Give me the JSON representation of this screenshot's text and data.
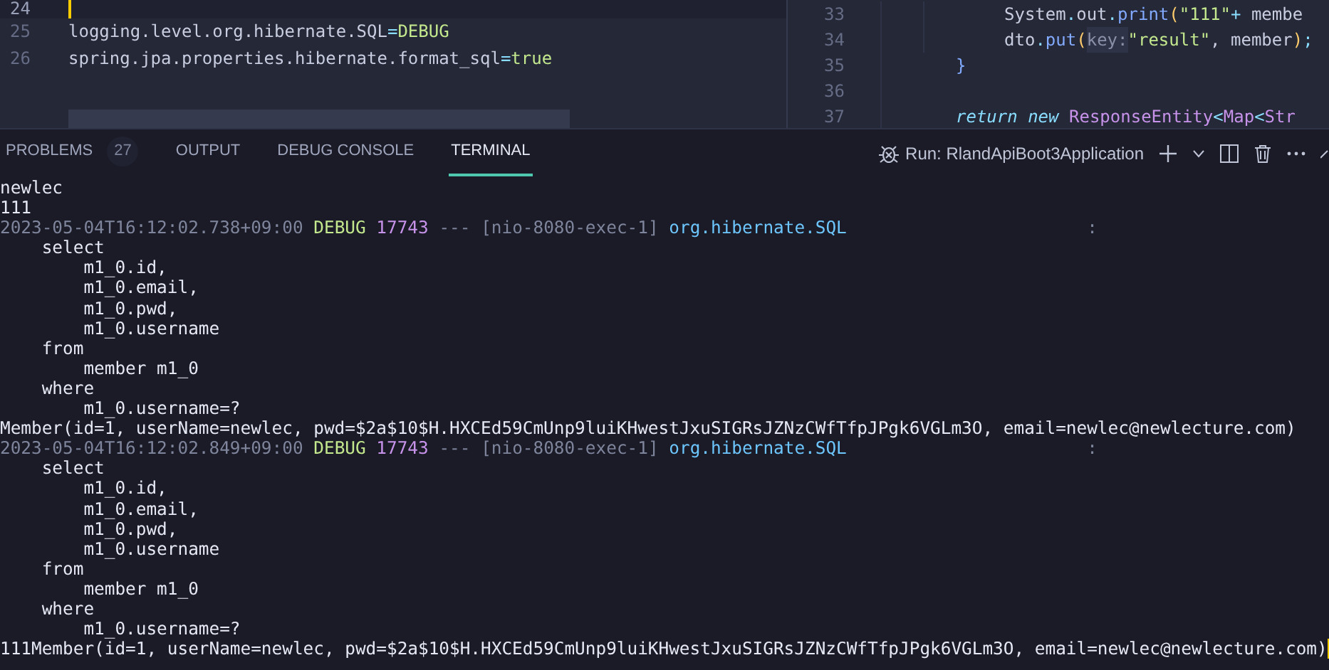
{
  "editor_left": {
    "lines": [
      {
        "number": "24",
        "current": true
      },
      {
        "number": "25",
        "current": false,
        "tokens": [
          {
            "text": "logging.level.org.hibernate.SQL",
            "kind": "plain"
          },
          {
            "text": "=",
            "kind": "punct"
          },
          {
            "text": "DEBUG",
            "kind": "string"
          }
        ]
      },
      {
        "number": "26",
        "current": false,
        "tokens": [
          {
            "text": "spring.jpa.properties.hibernate.format_sql",
            "kind": "plain"
          },
          {
            "text": "=",
            "kind": "punct"
          },
          {
            "text": "true",
            "kind": "string"
          }
        ]
      }
    ]
  },
  "editor_right": {
    "lines": [
      {
        "number": "33",
        "kind": "inner",
        "tokens": [
          {
            "text": "System",
            "kind": "plain"
          },
          {
            "text": ".",
            "kind": "punct"
          },
          {
            "text": "out",
            "kind": "plain"
          },
          {
            "text": ".",
            "kind": "punct"
          },
          {
            "text": "print",
            "kind": "method"
          },
          {
            "text": "(",
            "kind": "paren"
          },
          {
            "text": "\"111\"",
            "kind": "string"
          },
          {
            "text": "+",
            "kind": "punct"
          },
          {
            "text": " membe",
            "kind": "plain"
          }
        ]
      },
      {
        "number": "34",
        "kind": "inner",
        "tokens": [
          {
            "text": "dto",
            "kind": "plain"
          },
          {
            "text": ".",
            "kind": "punct"
          },
          {
            "text": "put",
            "kind": "method"
          },
          {
            "text": "(",
            "kind": "paren"
          },
          {
            "text": "key:",
            "kind": "hint"
          },
          {
            "text": "\"result\"",
            "kind": "string"
          },
          {
            "text": ", member",
            "kind": "plain"
          },
          {
            "text": ")",
            "kind": "paren"
          },
          {
            "text": ";",
            "kind": "punct"
          }
        ]
      },
      {
        "number": "35",
        "kind": "outer",
        "tokens": [
          {
            "text": "}",
            "kind": "brace"
          }
        ]
      },
      {
        "number": "36",
        "kind": "outer"
      },
      {
        "number": "37",
        "kind": "outer",
        "tokens": [
          {
            "text": "return",
            "kind": "keyword"
          },
          {
            "text": " new",
            "kind": "keyword"
          },
          {
            "text": " ResponseEntity",
            "kind": "type"
          },
          {
            "text": "<",
            "kind": "punct"
          },
          {
            "text": "Map",
            "kind": "type"
          },
          {
            "text": "<",
            "kind": "punct"
          },
          {
            "text": "Str",
            "kind": "type"
          }
        ]
      }
    ]
  },
  "panel_tabs": [
    {
      "label": "PROBLEMS",
      "badge": "27",
      "selected": false
    },
    {
      "label": "OUTPUT",
      "selected": false
    },
    {
      "label": "DEBUG CONSOLE",
      "selected": false
    },
    {
      "label": "TERMINAL",
      "selected": true
    }
  ],
  "run_config": "Run: RlandApiBoot3Application",
  "terminal": {
    "lines": [
      {
        "kind": "plain",
        "text": "newlec"
      },
      {
        "kind": "plain",
        "text": "111"
      },
      {
        "kind": "log",
        "timestamp": "2023-05-04T16:12:02.738+09:00",
        "level": "DEBUG",
        "pid": "17743",
        "separator": "---",
        "thread": "[nio-8080-exec-1]",
        "logger": "org.hibernate.SQL",
        "colon": ":"
      },
      {
        "kind": "plain",
        "text": "    select"
      },
      {
        "kind": "plain",
        "text": "        m1_0.id,"
      },
      {
        "kind": "plain",
        "text": "        m1_0.email,"
      },
      {
        "kind": "plain",
        "text": "        m1_0.pwd,"
      },
      {
        "kind": "plain",
        "text": "        m1_0.username"
      },
      {
        "kind": "plain",
        "text": "    from"
      },
      {
        "kind": "plain",
        "text": "        member m1_0"
      },
      {
        "kind": "plain",
        "text": "    where"
      },
      {
        "kind": "plain",
        "text": "        m1_0.username=?"
      },
      {
        "kind": "plain",
        "text": "Member(id=1, userName=newlec, pwd=$2a$10$H.HXCEd59CmUnp9luiKHwestJxuSIGRsJZNzCWfTfpJPgk6VGLm3O, email=newlec@newlecture.com)"
      },
      {
        "kind": "log",
        "timestamp": "2023-05-04T16:12:02.849+09:00",
        "level": "DEBUG",
        "pid": "17743",
        "separator": "---",
        "thread": "[nio-8080-exec-1]",
        "logger": "org.hibernate.SQL",
        "colon": ":"
      },
      {
        "kind": "plain",
        "text": "    select"
      },
      {
        "kind": "plain",
        "text": "        m1_0.id,"
      },
      {
        "kind": "plain",
        "text": "        m1_0.email,"
      },
      {
        "kind": "plain",
        "text": "        m1_0.pwd,"
      },
      {
        "kind": "plain",
        "text": "        m1_0.username"
      },
      {
        "kind": "plain",
        "text": "    from"
      },
      {
        "kind": "plain",
        "text": "        member m1_0"
      },
      {
        "kind": "plain",
        "text": "    where"
      },
      {
        "kind": "plain",
        "text": "        m1_0.username=?"
      },
      {
        "kind": "prompt",
        "text": "111Member(id=1, userName=newlec, pwd=$2a$10$H.HXCEd59CmUnp9luiKHwestJxuSIGRsJZNzCWfTfpJPgk6VGLm3O, email=newlec@newlecture.com)"
      }
    ]
  }
}
